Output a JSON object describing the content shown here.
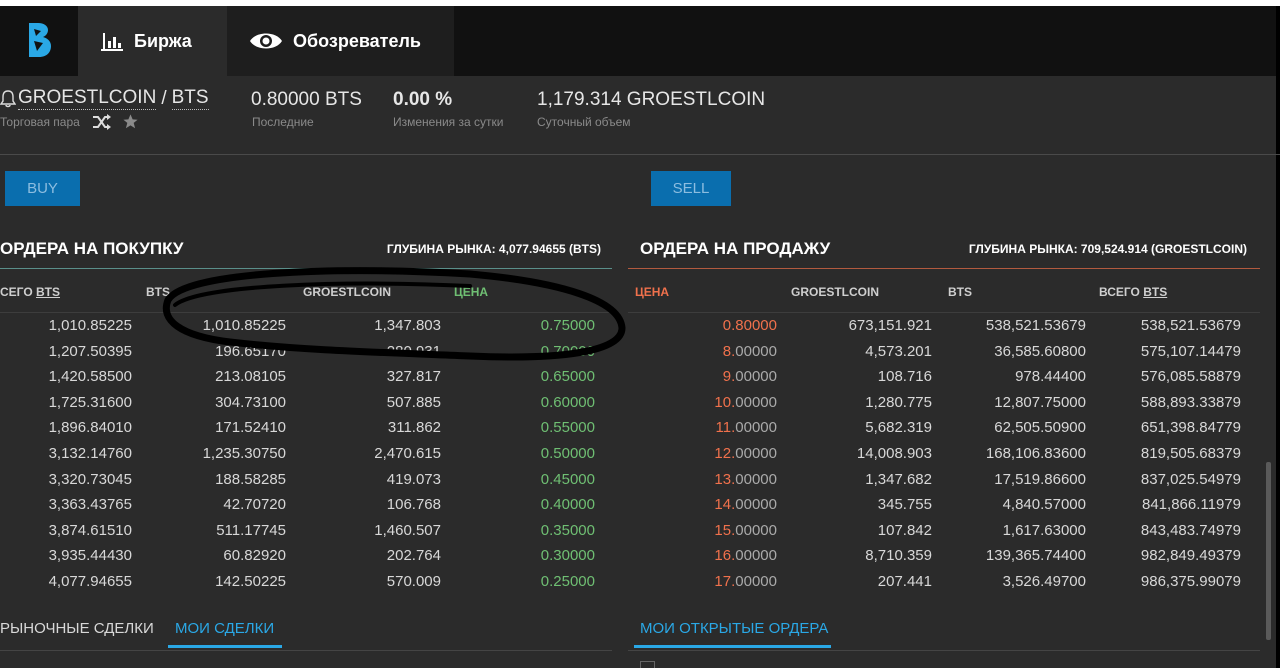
{
  "nav": {
    "exchange_label": "Биржа",
    "explorer_label": "Обозреватель"
  },
  "header": {
    "base": "GROESTLCOIN",
    "separator": "/",
    "quote": "BTS",
    "pair_label": "Торговая пара",
    "last_price": "0.80000 BTS",
    "last_label": "Последние",
    "change": "0.00 %",
    "change_label": "Изменения за сутки",
    "volume": "1,179.314 GROESTLCOIN",
    "volume_label": "Суточный объем"
  },
  "buttons": {
    "buy": "BUY",
    "sell": "SELL"
  },
  "buy_orders": {
    "title": "ОРДЕРА НА ПОКУПКУ",
    "depth": "ГЛУБИНА РЫНКА: 4,077.94655 (BTS)",
    "col_total_prefix": "СЕГО",
    "col_total_link": "BTS",
    "col_bts": "BTS",
    "col_groestlcoin": "GROESTLCOIN",
    "col_price": "ЦЕНА",
    "rows": [
      {
        "total": "1,010.85225",
        "bts": "1,010.85225",
        "grs": "1,347.803",
        "price": "0.75000"
      },
      {
        "total": "1,207.50395",
        "bts": "196.65170",
        "grs": "280.931",
        "price": "0.70000"
      },
      {
        "total": "1,420.58500",
        "bts": "213.08105",
        "grs": "327.817",
        "price": "0.65000"
      },
      {
        "total": "1,725.31600",
        "bts": "304.73100",
        "grs": "507.885",
        "price": "0.60000"
      },
      {
        "total": "1,896.84010",
        "bts": "171.52410",
        "grs": "311.862",
        "price": "0.55000"
      },
      {
        "total": "3,132.14760",
        "bts": "1,235.30750",
        "grs": "2,470.615",
        "price": "0.50000"
      },
      {
        "total": "3,320.73045",
        "bts": "188.58285",
        "grs": "419.073",
        "price": "0.45000"
      },
      {
        "total": "3,363.43765",
        "bts": "42.70720",
        "grs": "106.768",
        "price": "0.40000"
      },
      {
        "total": "3,874.61510",
        "bts": "511.17745",
        "grs": "1,460.507",
        "price": "0.35000"
      },
      {
        "total": "3,935.44430",
        "bts": "60.82920",
        "grs": "202.764",
        "price": "0.30000"
      },
      {
        "total": "4,077.94655",
        "bts": "142.50225",
        "grs": "570.009",
        "price": "0.25000"
      }
    ]
  },
  "sell_orders": {
    "title": "ОРДЕРА НА ПРОДАЖУ",
    "depth": "ГЛУБИНА РЫНКА: 709,524.914 (GROESTLCOIN)",
    "col_price": "ЦЕНА",
    "col_groestlcoin": "GROESTLCOIN",
    "col_bts": "BTS",
    "col_total_prefix": "ВСЕГО",
    "col_total_link": "BTS",
    "rows": [
      {
        "price_int": "0.8",
        "price_dec": "0000",
        "grs": "673,151.921",
        "bts": "538,521.53679",
        "total": "538,521.53679"
      },
      {
        "price_int": "8.",
        "price_dec": "00000",
        "grs": "4,573.201",
        "bts": "36,585.60800",
        "total": "575,107.14479"
      },
      {
        "price_int": "9.",
        "price_dec": "00000",
        "grs": "108.716",
        "bts": "978.44400",
        "total": "576,085.58879"
      },
      {
        "price_int": "10.",
        "price_dec": "00000",
        "grs": "1,280.775",
        "bts": "12,807.75000",
        "total": "588,893.33879"
      },
      {
        "price_int": "11.",
        "price_dec": "00000",
        "grs": "5,682.319",
        "bts": "62,505.50900",
        "total": "651,398.84779"
      },
      {
        "price_int": "12.",
        "price_dec": "00000",
        "grs": "14,008.903",
        "bts": "168,106.83600",
        "total": "819,505.68379"
      },
      {
        "price_int": "13.",
        "price_dec": "00000",
        "grs": "1,347.682",
        "bts": "17,519.86600",
        "total": "837,025.54979"
      },
      {
        "price_int": "14.",
        "price_dec": "00000",
        "grs": "345.755",
        "bts": "4,840.57000",
        "total": "841,866.11979"
      },
      {
        "price_int": "15.",
        "price_dec": "00000",
        "grs": "107.842",
        "bts": "1,617.63000",
        "total": "843,483.74979"
      },
      {
        "price_int": "16.",
        "price_dec": "00000",
        "grs": "8,710.359",
        "bts": "139,365.74400",
        "total": "982,849.49379"
      },
      {
        "price_int": "17.",
        "price_dec": "00000",
        "grs": "207.441",
        "bts": "3,526.49700",
        "total": "986,375.99079"
      }
    ]
  },
  "bottom_tabs": {
    "market_trades": "РЫНОЧНЫЕ СДЕЛКИ",
    "my_trades": "МОИ СДЕЛКИ",
    "my_open_orders": "МОИ ОТКРЫТЫЕ ОРДЕРА"
  },
  "colors": {
    "accent": "#2aa8e6",
    "button": "#0a6eae",
    "buy_price": "#6fbf73",
    "sell_price": "#f0714c"
  },
  "icons": [
    "bitshares-logo-icon",
    "bar-chart-icon",
    "eye-icon",
    "bell-icon",
    "shuffle-icon",
    "star-icon"
  ]
}
